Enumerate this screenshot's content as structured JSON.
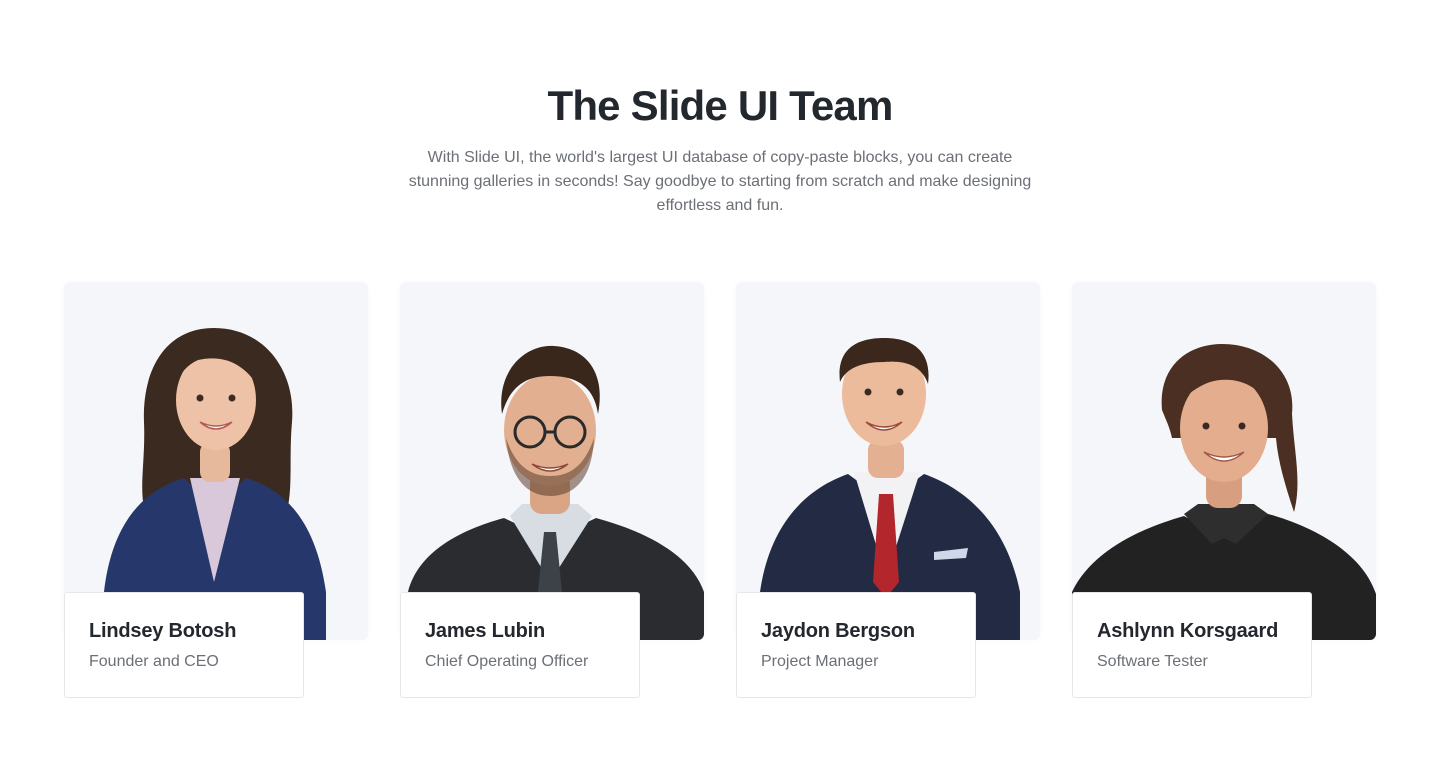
{
  "section": {
    "title": "The Slide UI Team",
    "subtitle": "With Slide UI, the world's largest UI database of copy-paste blocks, you can create stunning galleries in seconds! Say goodbye to starting from scratch and make designing effortless and fun."
  },
  "team": [
    {
      "name": "Lindsey Botosh",
      "role": "Founder and CEO"
    },
    {
      "name": "James Lubin",
      "role": "Chief Operating Officer"
    },
    {
      "name": "Jaydon Bergson",
      "role": "Project Manager"
    },
    {
      "name": "Ashlynn Korsgaard",
      "role": "Software Tester"
    }
  ],
  "colors": {
    "card_background": "#f5f6f9",
    "title": "#23272e",
    "muted_text": "#6b6f76",
    "border": "#e6e7ea"
  }
}
